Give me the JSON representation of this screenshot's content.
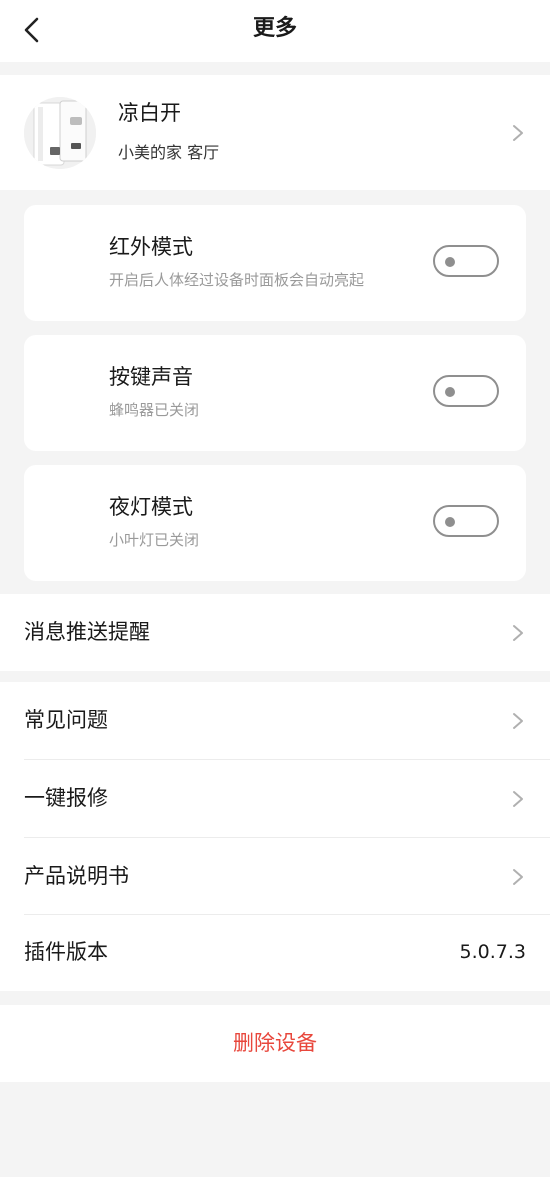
{
  "header": {
    "title": "更多",
    "back_icon": "chevron-left-icon"
  },
  "device": {
    "name": "凉白开",
    "location": "小美的家 客厅",
    "image_icon": "water-dispenser-image"
  },
  "toggles": [
    {
      "title": "红外模式",
      "desc": "开启后人体经过设备时面板会自动亮起",
      "on": false
    },
    {
      "title": "按键声音",
      "desc": "蜂鸣器已关闭",
      "on": false
    },
    {
      "title": "夜灯模式",
      "desc": "小叶灯已关闭",
      "on": false
    }
  ],
  "menu": {
    "notifications": "消息推送提醒",
    "faq": "常见问题",
    "repair": "一键报修",
    "manual": "产品说明书",
    "plugin_version_label": "插件版本",
    "plugin_version_value": "5.0.7.3"
  },
  "delete": {
    "label": "删除设备"
  },
  "colors": {
    "danger": "#e8473c",
    "switch_off": "#8f8f8f",
    "background": "#f4f4f4"
  }
}
